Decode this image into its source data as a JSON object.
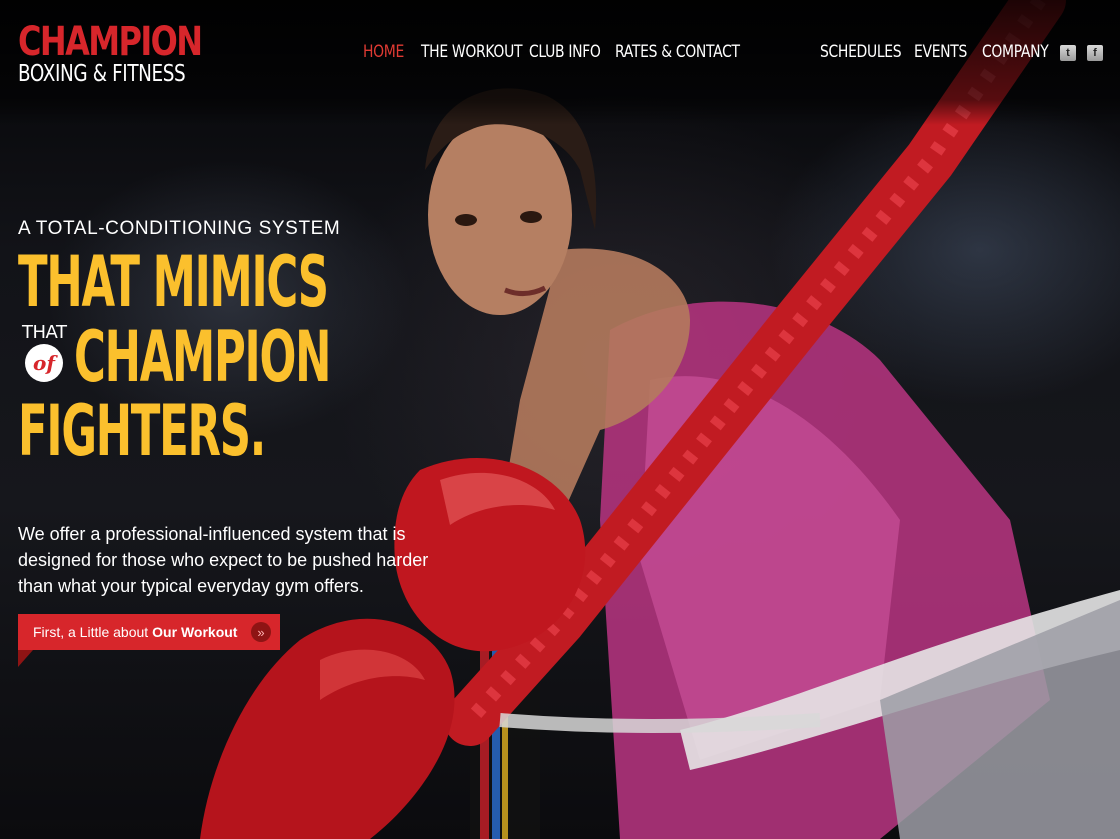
{
  "brand": {
    "name_top": "CHAMPION",
    "name_bottom": "BOXING & FITNESS"
  },
  "nav_main": [
    {
      "label": "HOME",
      "active": true
    },
    {
      "label": "THE WORKOUT",
      "active": false
    },
    {
      "label": "CLUB INFO",
      "active": false
    },
    {
      "label": "RATES & CONTACT",
      "active": false
    }
  ],
  "nav_secondary": [
    {
      "label": "SCHEDULES"
    },
    {
      "label": "EVENTS"
    },
    {
      "label": "COMPANY"
    }
  ],
  "social": [
    {
      "icon": "twitter-icon",
      "glyph": "t"
    },
    {
      "icon": "facebook-icon",
      "glyph": "f"
    }
  ],
  "hero": {
    "kicker": "A TOTAL-CONDITIONING SYSTEM",
    "line1": "THAT MIMICS",
    "connector_that": "THAT",
    "connector_of": "of",
    "line2": "CHAMPION",
    "line3": "FIGHTERS.",
    "intro": "We offer a professional-influenced system that is designed for those who expect to be pushed harder than what your typical everyday gym offers.",
    "cta_prefix": "First, a Little about",
    "cta_bold": "Our Workout",
    "cta_icon": "double-chevron-right-icon",
    "cta_arrow_glyph": "»"
  },
  "colors": {
    "accent_red": "#d7262b",
    "headline_yellow": "#fbc02d",
    "background": "#0a0a0c"
  }
}
